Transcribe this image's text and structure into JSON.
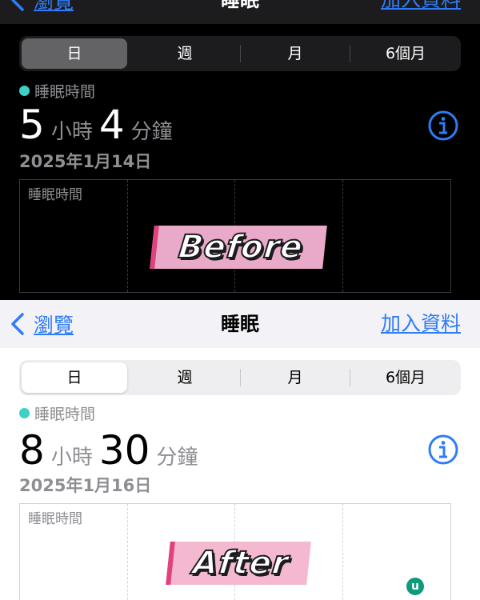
{
  "colors": {
    "accent": "#2f7cf6",
    "sleep_dot": "#3ecfc5",
    "badge_pink": "#e9a9c8",
    "badge_edge": "#e0427f"
  },
  "nav": {
    "back_label": "瀏覽",
    "title": "睡眠",
    "add_label": "加入資料"
  },
  "segments": [
    "日",
    "週",
    "月",
    "6個月"
  ],
  "metric_label": "睡眠時間",
  "chart_label": "睡眠時間",
  "before": {
    "badge": "Before",
    "hours": "5",
    "hours_unit": "小時",
    "minutes": "4",
    "minutes_unit": "分鐘",
    "date": "2025年1月14日"
  },
  "after": {
    "badge": "After",
    "hours": "8",
    "hours_unit": "小時",
    "minutes": "30",
    "minutes_unit": "分鐘",
    "date": "2025年1月16日"
  }
}
